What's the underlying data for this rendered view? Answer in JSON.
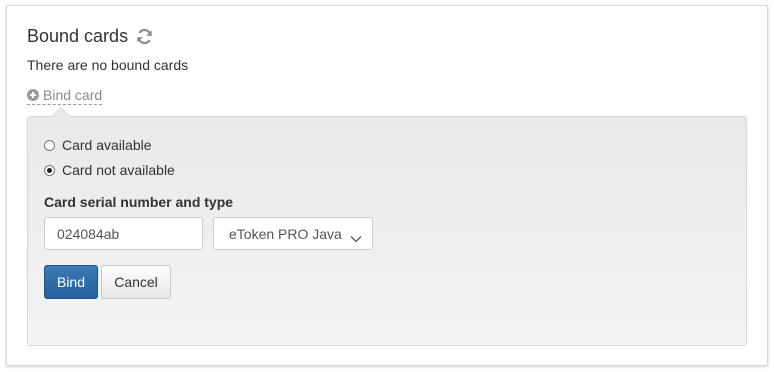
{
  "section": {
    "title": "Bound cards",
    "refresh_icon": "refresh-icon",
    "empty_message": "There are no bound cards",
    "bind_link_label": "Bind card",
    "bind_link_icon": "plus-circle-icon"
  },
  "form": {
    "options": [
      {
        "label": "Card available",
        "checked": false
      },
      {
        "label": "Card not available",
        "checked": true
      }
    ],
    "serial_label": "Card serial number and type",
    "serial_value": "024084ab",
    "type_value": "eToken PRO Java",
    "bind_button": "Bind",
    "cancel_button": "Cancel"
  },
  "colors": {
    "primary": "#2d6ca8",
    "link": "#8a8a8a"
  }
}
